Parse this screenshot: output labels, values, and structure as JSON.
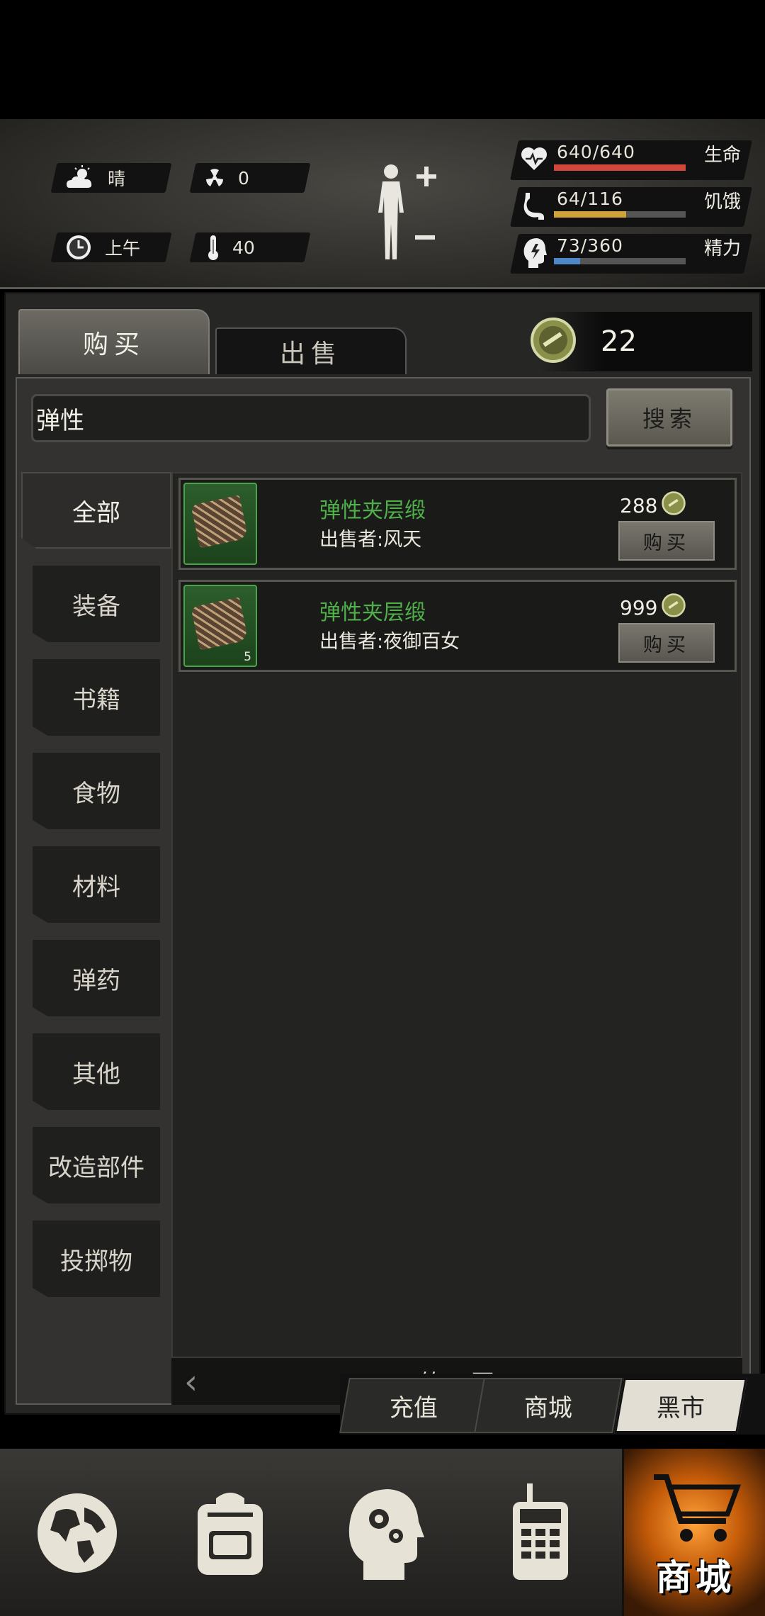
{
  "status": {
    "weather": "晴",
    "radiation": "0",
    "time_of_day": "上午",
    "temperature": "40",
    "health": {
      "value": "640/640",
      "label": "生命",
      "fraction": 1.0,
      "color": "#d1473c"
    },
    "hunger": {
      "value": "64/116",
      "label": "饥饿",
      "fraction": 0.55,
      "color": "#d0a23a"
    },
    "energy": {
      "value": "73/360",
      "label": "精力",
      "fraction": 0.2,
      "color": "#4e88c6"
    }
  },
  "tabs": {
    "buy": "购买",
    "sell": "出售"
  },
  "coins": "22",
  "search": {
    "value": "弹性",
    "button": "搜索"
  },
  "categories": [
    "全部",
    "装备",
    "书籍",
    "食物",
    "材料",
    "弹药",
    "其他",
    "改造部件",
    "投掷物"
  ],
  "listings": [
    {
      "name": "弹性夹层缎",
      "seller": "出售者:风天",
      "price": "288",
      "count": "",
      "buy": "购买"
    },
    {
      "name": "弹性夹层缎",
      "seller": "出售者:夜御百女",
      "price": "999",
      "count": "5",
      "buy": "购买"
    }
  ],
  "pager": {
    "label": "第 1 页"
  },
  "store_tabs": {
    "recharge": "充值",
    "mall": "商城",
    "black_market": "黑市"
  },
  "bottom_nav": {
    "shop_label": "商城"
  },
  "icons": [
    "weather-sun-cloud-icon",
    "radiation-icon",
    "clock-icon",
    "thermometer-icon",
    "body-icon",
    "heart-icon",
    "stomach-icon",
    "energy-head-icon",
    "coin-icon",
    "globe-icon",
    "backpack-icon",
    "brain-gear-icon",
    "radio-icon",
    "cart-icon"
  ]
}
